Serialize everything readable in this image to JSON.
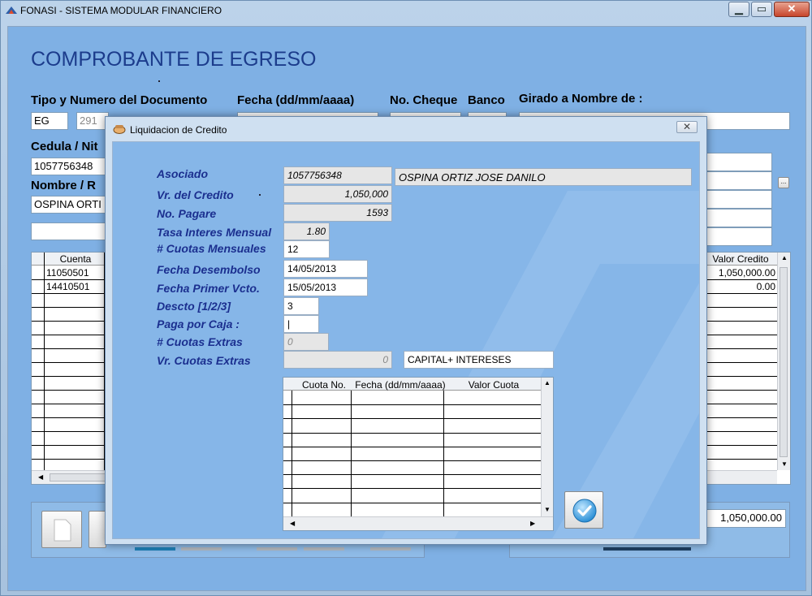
{
  "window": {
    "title": "FONASI - SISTEMA MODULAR FINANCIERO"
  },
  "form": {
    "title": "COMPROBANTE DE EGRESO",
    "headers": {
      "doc": "Tipo y Numero del Documento",
      "fecha": "Fecha (dd/mm/aaaa)",
      "cheque": "No. Cheque",
      "banco": "Banco",
      "girado": "Girado a Nombre de :",
      "cedula": "Cedula / Nit",
      "nombre": "Nombre / R"
    },
    "values": {
      "doc_type": "EG",
      "doc_number": "291",
      "cedula": "1057756348",
      "nombre": "OSPINA ORTI"
    },
    "grid": {
      "col_cuenta": "Cuenta",
      "col_valor_credito": "Valor Credito",
      "rows": [
        {
          "cuenta": "11050501",
          "valor_credito": "1,050,000.00"
        },
        {
          "cuenta": "14410501",
          "valor_credito": "0.00"
        }
      ]
    },
    "total": "1,050,000.00"
  },
  "dialog": {
    "title": "Liquidacion de Credito",
    "close": "✕",
    "labels": {
      "asociado": "Asociado",
      "vr_credito": "Vr. del Credito",
      "no_pagare": "No. Pagare",
      "tasa": "Tasa Interes Mensual",
      "cuotas": "# Cuotas Mensuales",
      "fecha_desembolso": "Fecha Desembolso",
      "fecha_primer": "Fecha Primer Vcto.",
      "descto": "Descto [1/2/3]",
      "paga_caja": "Paga por Caja :",
      "cuotas_extras": "# Cuotas Extras",
      "vr_cuotas_extras": "Vr. Cuotas Extras"
    },
    "values": {
      "asociado_id": "1057756348",
      "asociado_nombre": "OSPINA ORTIZ JOSE DANILO",
      "vr_credito": "1,050,000",
      "no_pagare": "1593",
      "tasa": "1.80",
      "cuotas": "12",
      "fecha_desembolso": "14/05/2013",
      "fecha_primer": "15/05/2013",
      "descto": "3",
      "paga_caja": "|",
      "cuotas_extras": "0",
      "vr_cuotas_extras": "0",
      "modalidad": "CAPITAL+ INTERESES"
    },
    "grid": {
      "col_cuota": "Cuota No.",
      "col_fecha": "Fecha (dd/mm/aaaa)",
      "col_valor": "Valor Cuota"
    }
  },
  "colors": {
    "accent": "#1c3c8c",
    "label": "#1b2f8f",
    "client_bg": "#7fb0e4",
    "dialog_bg": "#86b6e8"
  },
  "icons": {
    "app": "app-logo-icon",
    "dialog": "hand-icon",
    "confirm": "checkmark-icon"
  }
}
